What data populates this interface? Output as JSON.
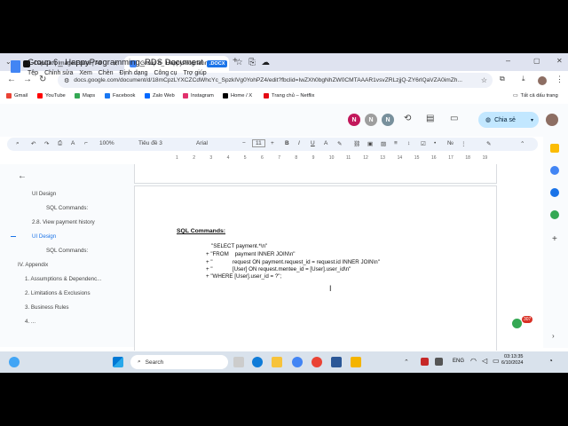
{
  "browser": {
    "tabs": [
      {
        "label": "CapCut | Image Editor | All",
        "active": false
      },
      {
        "label": "Group 6_ HappyProgramming_",
        "active": true
      }
    ],
    "new_tab": "+",
    "url": "docs.google.com/document/d/18mCpzLYXCZCdWhcYc_SpzkIVg0YohPZ4/edit?fbclid=IwZXh0bgNhZW0CMTAAAR1vsvZRLzjjQ-ZY6rlQaVZA0imZh...",
    "bookmarks": [
      {
        "label": "Gmail",
        "color": "#ea4335"
      },
      {
        "label": "YouTube",
        "color": "#ff0000"
      },
      {
        "label": "Maps",
        "color": "#34a853"
      },
      {
        "label": "Facebook",
        "color": "#1877f2"
      },
      {
        "label": "Zalo Web",
        "color": "#0068ff"
      },
      {
        "label": "Instagram",
        "color": "#e1306c"
      },
      {
        "label": "Home / X",
        "color": "#000000"
      },
      {
        "label": "Trang chủ – Netflix",
        "color": "#e50914"
      }
    ],
    "all_bookmarks": "Tất cả dấu trang"
  },
  "docs": {
    "title": "Group 6_ HappyProgramming_RDS Document",
    "badge": ".DOCX",
    "menu": [
      "Tệp",
      "Chỉnh sửa",
      "Xem",
      "Chèn",
      "Định dạng",
      "Công cụ",
      "Trợ giúp"
    ],
    "avatars": [
      {
        "letter": "N",
        "color": "#c2185b"
      },
      {
        "letter": "N",
        "color": "#9e9e9e"
      },
      {
        "letter": "N",
        "color": "#78909c"
      }
    ],
    "share_label": "Chia sẻ",
    "toolbar": {
      "zoom": "100%",
      "style": "Tiêu đề 3",
      "font": "Arial",
      "font_size": "11",
      "minus": "−",
      "plus": "+"
    },
    "ruler_ticks": [
      "1",
      "2",
      "3",
      "4",
      "5",
      "6",
      "7",
      "8",
      "9",
      "10",
      "11",
      "12",
      "13",
      "14",
      "15",
      "16",
      "17",
      "18",
      "19"
    ]
  },
  "outline": {
    "items": [
      {
        "label": "UI Design",
        "level": 2,
        "active": false
      },
      {
        "label": "SQL Commands:",
        "level": 3,
        "active": false
      },
      {
        "label": "2.8. View payment history",
        "level": 2,
        "active": false
      },
      {
        "label": "UI Design",
        "level": 2,
        "active": true
      },
      {
        "label": "SQL Commands:",
        "level": 3,
        "active": false
      },
      {
        "label": "IV. Appendix",
        "level": 1,
        "active": false
      },
      {
        "label": "1. Assumptions & Dependenc...",
        "level": 2,
        "active": false
      },
      {
        "label": "2. Limitations & Exclusions",
        "level": 2,
        "active": false
      },
      {
        "label": "3. Business Rules",
        "level": 2,
        "active": false
      },
      {
        "label": "4. ...",
        "level": 2,
        "active": false
      }
    ]
  },
  "content": {
    "heading": "SQL Commands:",
    "lines": [
      "\"SELECT payment.*\\n\"",
      "+ \"FROM    payment INNER JOIN\\n\"",
      "+ \"             request ON payment.request_id = request.id INNER JOIN\\n\"",
      "+ \"             [User] ON request.mentee_id = [User].user_id\\n\"",
      "+ \"WHERE [User].user_id = ?\";"
    ]
  },
  "taskbar": {
    "search": "Search",
    "lang": "ENG",
    "time": "03:13:35",
    "date": "6/10/2024",
    "badge_count": "307"
  }
}
